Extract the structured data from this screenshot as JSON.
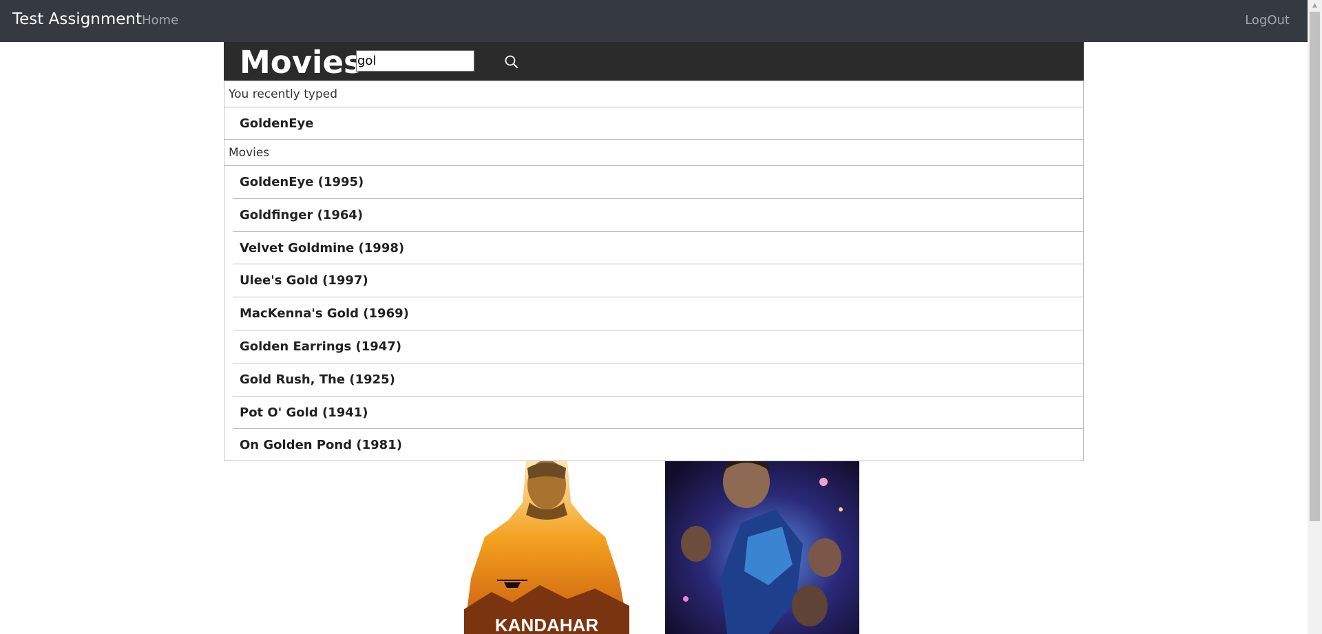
{
  "navbar": {
    "brand": "Test Assignment",
    "home_label": "Home",
    "logout_label": "LogOut"
  },
  "header": {
    "title": "Movies",
    "search_value": "gol",
    "search_icon": "search-icon"
  },
  "dropdown": {
    "recent_header": "You recently typed",
    "recent_items": [
      "GoldenEye"
    ],
    "movies_header": "Movies",
    "movies": [
      "GoldenEye (1995)",
      "Goldfinger (1964)",
      "Velvet Goldmine (1998)",
      "Ulee's Gold (1997)",
      "MacKenna's Gold (1969)",
      "Golden Earrings (1947)",
      "Gold Rush, The (1925)",
      "Pot O' Gold (1941)",
      "On Golden Pond (1981)"
    ]
  },
  "posters": {
    "kandahar_title": "KANDAHAR"
  }
}
